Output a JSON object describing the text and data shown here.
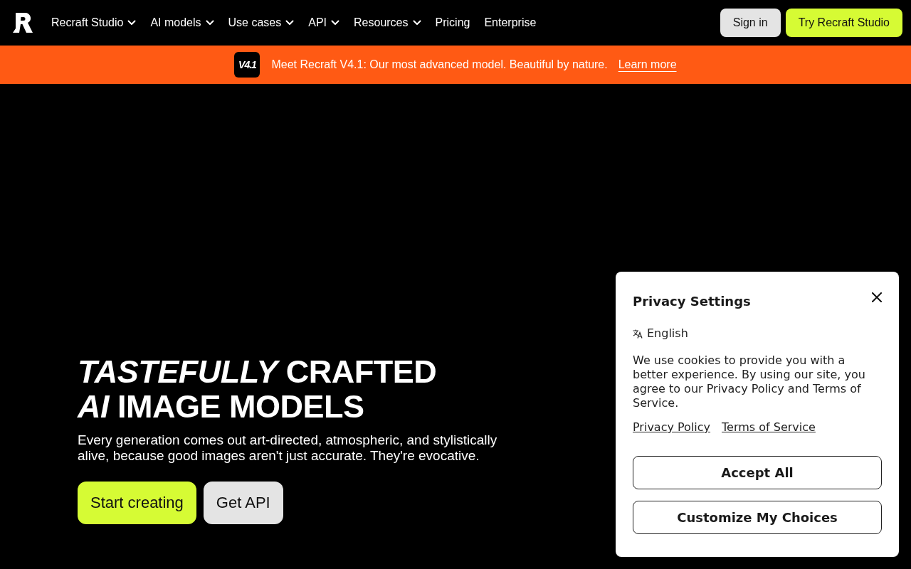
{
  "nav": {
    "items": [
      {
        "label": "Recraft Studio",
        "kind": "dropdown"
      },
      {
        "label": "AI models",
        "kind": "dropdown"
      },
      {
        "label": "Use cases",
        "kind": "dropdown"
      },
      {
        "label": "API",
        "kind": "dropdown"
      },
      {
        "label": "Resources",
        "kind": "dropdown"
      },
      {
        "label": "Pricing",
        "kind": "link"
      },
      {
        "label": "Enterprise",
        "kind": "link"
      }
    ],
    "buttons": [
      {
        "label": "Sign in",
        "kind": "secondary"
      },
      {
        "label": "Try Recraft Studio",
        "kind": "primary"
      }
    ]
  },
  "banner": {
    "badge": "V4.1",
    "message": "Meet Recraft V4.1: Our most advanced model. Beautiful by nature.",
    "link": "Learn more"
  },
  "hero": {
    "heading": [
      "*TASTEFULLY* CRAFTED",
      "*AI* IMAGE MODELS"
    ],
    "text": "Every generation comes out art-directed, atmospheric, and stylistically alive, because good images aren't just accurate. They're evocative.",
    "buttons": [
      {
        "label": "Start creating",
        "kind": "primary"
      },
      {
        "label": "Get API",
        "kind": "secondary"
      }
    ]
  },
  "cookie_dialog": {
    "title": "Privacy Settings",
    "language": "English",
    "text": "We use cookies to provide you with a better experience. By using our site, you agree to our Privacy Policy and Terms of Service.",
    "links": [
      "Privacy Policy",
      "Terms of Service"
    ],
    "buttons": [
      "Accept All",
      "Customize My Choices"
    ]
  }
}
